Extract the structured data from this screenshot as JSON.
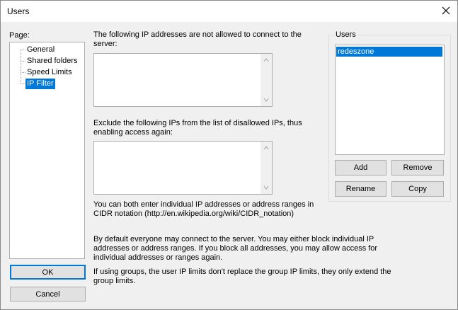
{
  "window": {
    "title": "Users",
    "close_icon": "close-icon"
  },
  "page_label": "Page:",
  "tree": {
    "items": [
      {
        "label": "General",
        "selected": false
      },
      {
        "label": "Shared folders",
        "selected": false
      },
      {
        "label": "Speed Limits",
        "selected": false
      },
      {
        "label": "IP Filter",
        "selected": true
      }
    ]
  },
  "disallowed": {
    "label": "The following IP addresses are not allowed to connect to the server:",
    "value": ""
  },
  "exclude": {
    "label": "Exclude the following IPs from the list of disallowed IPs, thus enabling access again:",
    "value": ""
  },
  "hint_cidr": "You can both enter individual IP addresses or address ranges in CIDR notation (http://en.wikipedia.org/wiki/CIDR_notation)",
  "hint_default": "By default everyone may connect to the server. You may either block individual IP addresses or address ranges. If you block all addresses, you may allow access for individual addresses or ranges again.",
  "hint_groups": "If using groups, the user IP limits don't replace the group IP limits, they only extend the group limits.",
  "users_group": {
    "title": "Users",
    "users": [
      "redeszone"
    ],
    "selected_user": "redeszone"
  },
  "buttons": {
    "add": "Add",
    "remove": "Remove",
    "rename": "Rename",
    "copy": "Copy",
    "ok": "OK",
    "cancel": "Cancel"
  },
  "colors": {
    "selection": "#0078d7",
    "dialog_bg": "#f0f0f0",
    "titlebar_bg": "#ffffff",
    "button_bg": "#e1e1e1"
  }
}
